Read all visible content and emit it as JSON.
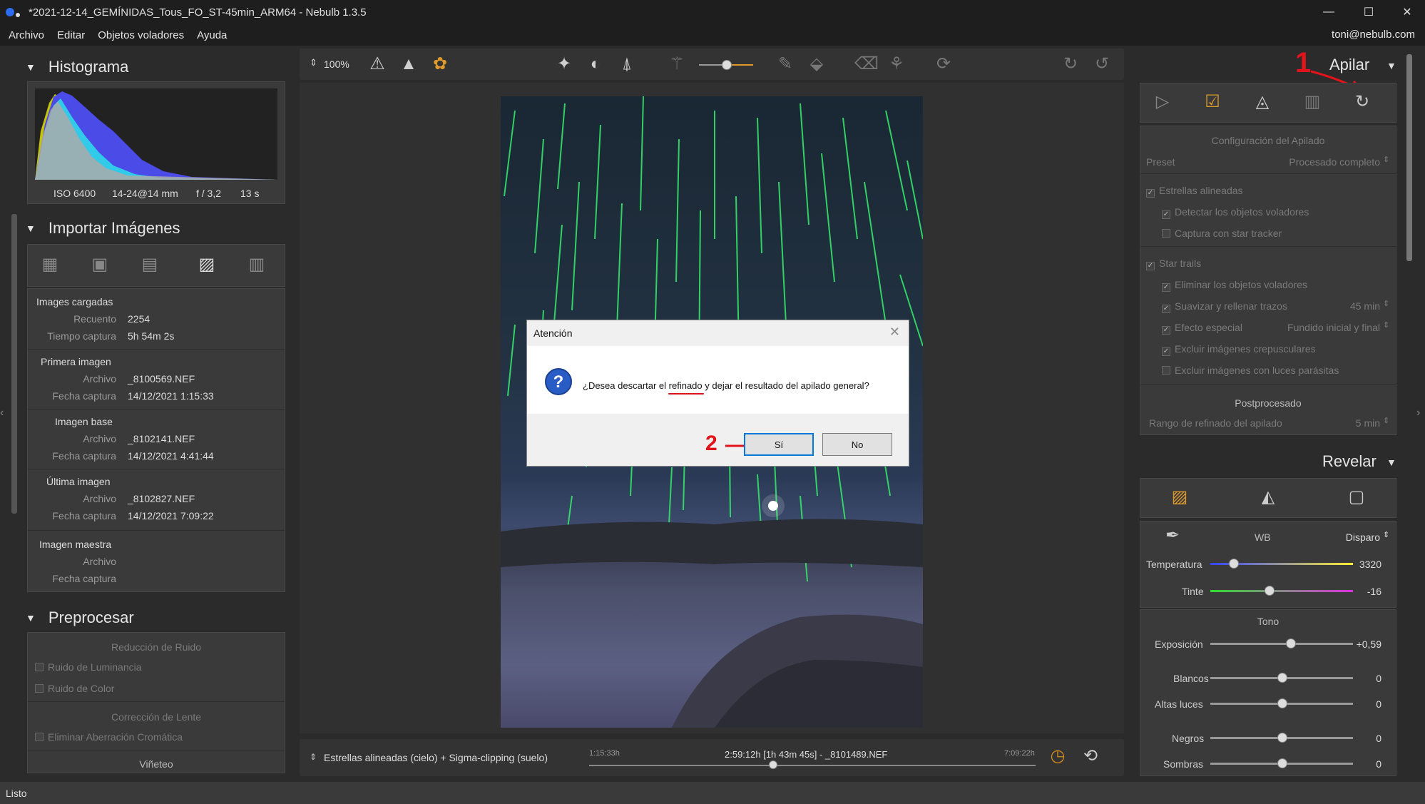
{
  "window": {
    "title": "*2021-12-14_GEMÍNIDAS_Tous_FO_ST-45min_ARM64 - Nebulb 1.3.5",
    "minimize": "—",
    "maximize": "☐",
    "close": "✕"
  },
  "menu": {
    "items": [
      "Archivo",
      "Editar",
      "Objetos voladores",
      "Ayuda"
    ],
    "user": "toni@nebulb.com"
  },
  "histogram": {
    "title": "Histograma",
    "iso": "ISO 6400",
    "lens": "14-24@14 mm",
    "aperture": "f / 3,2",
    "exposure": "13 s"
  },
  "import": {
    "title": "Importar Imágenes",
    "loaded": {
      "heading": "Images cargadas",
      "count_label": "Recuento",
      "count": "2254",
      "time_label": "Tiempo captura",
      "time": "5h 54m 2s"
    },
    "first": {
      "heading": "Primera imagen",
      "file_label": "Archivo",
      "file": "_8100569.NEF",
      "date_label": "Fecha captura",
      "date": "14/12/2021 1:15:33"
    },
    "base": {
      "heading": "Imagen base",
      "file_label": "Archivo",
      "file": "_8102141.NEF",
      "date_label": "Fecha captura",
      "date": "14/12/2021 4:41:44"
    },
    "last": {
      "heading": "Última imagen",
      "file_label": "Archivo",
      "file": "_8102827.NEF",
      "date_label": "Fecha captura",
      "date": "14/12/2021 7:09:22"
    },
    "master": {
      "heading": "Imagen maestra",
      "file_label": "Archivo",
      "date_label": "Fecha captura"
    }
  },
  "preprocess": {
    "title": "Preprocesar",
    "noise_heading": "Reducción de Ruido",
    "lum_noise": "Ruido de Luminancia",
    "color_noise": "Ruido de Color",
    "lens_heading": "Corrección de Lente",
    "chromatic": "Eliminar Aberración Cromática",
    "vignette": "Viñeteo"
  },
  "toolbar": {
    "zoom": "100%"
  },
  "statusstrip": {
    "mode": "Estrellas alineadas (cielo) + Sigma-clipping (suelo)",
    "start": "1:15:33h",
    "center": "2:59:12h [1h 43m 45s] - _8101489.NEF",
    "end": "7:09:22h"
  },
  "stack": {
    "title": "Apilar",
    "config_heading": "Configuración del Apilado",
    "preset_label": "Preset",
    "preset": "Procesado completo",
    "aligned": "Estrellas alineadas",
    "detect": "Detectar los objetos voladores",
    "tracker": "Captura con star tracker",
    "trails": "Star trails",
    "remove": "Eliminar los objetos voladores",
    "smooth": "Suavizar y rellenar trazos",
    "smooth_val": "45 min",
    "effect": "Efecto especial",
    "effect_val": "Fundido inicial y final",
    "twilight": "Excluir imágenes crepusculares",
    "parasitic": "Excluir imágenes con luces parásitas",
    "post_heading": "Postprocesado",
    "range_label": "Rango de refinado del apilado",
    "range_val": "5 min"
  },
  "develop": {
    "title": "Revelar",
    "wb_label": "WB",
    "wb_val": "Disparo",
    "temp_label": "Temperatura",
    "temp_val": "3320",
    "tint_label": "Tinte",
    "tint_val": "-16",
    "tone_heading": "Tono",
    "exposure_label": "Exposición",
    "exposure_val": "+0,59",
    "whites_label": "Blancos",
    "whites_val": "0",
    "highlights_label": "Altas luces",
    "highlights_val": "0",
    "blacks_label": "Negros",
    "blacks_val": "0",
    "shadows_label": "Sombras",
    "shadows_val": "0"
  },
  "dialog": {
    "title": "Atención",
    "message": "¿Desea descartar el refinado y dejar el resultado del apilado general?",
    "yes": "Sí",
    "no": "No"
  },
  "annotations": {
    "one": "1",
    "two": "2"
  },
  "status": {
    "text": "Listo"
  }
}
